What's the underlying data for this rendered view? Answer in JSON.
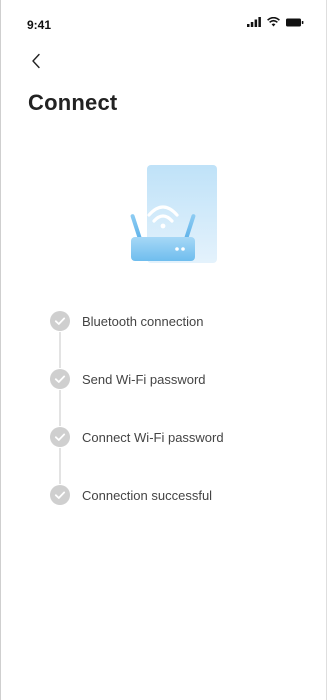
{
  "status_bar": {
    "time": "9:41",
    "icons": [
      "signal-icon",
      "wifi-icon",
      "battery-icon"
    ]
  },
  "nav": {
    "back_icon": "chevron-left-icon",
    "back_glyph": "‹"
  },
  "page": {
    "title": "Connect"
  },
  "hero": {
    "icon": "router-wifi-icon"
  },
  "steps": [
    {
      "label": "Bluetooth connection",
      "icon": "check-circle-icon"
    },
    {
      "label": "Send Wi-Fi password",
      "icon": "check-circle-icon"
    },
    {
      "label": "Connect Wi-Fi password",
      "icon": "check-circle-icon"
    },
    {
      "label": "Connection successful",
      "icon": "check-circle-icon"
    }
  ],
  "colors": {
    "step_icon": "#cfcfcf",
    "accent_light": "#d9ecfb",
    "accent": "#8ccaf0"
  }
}
